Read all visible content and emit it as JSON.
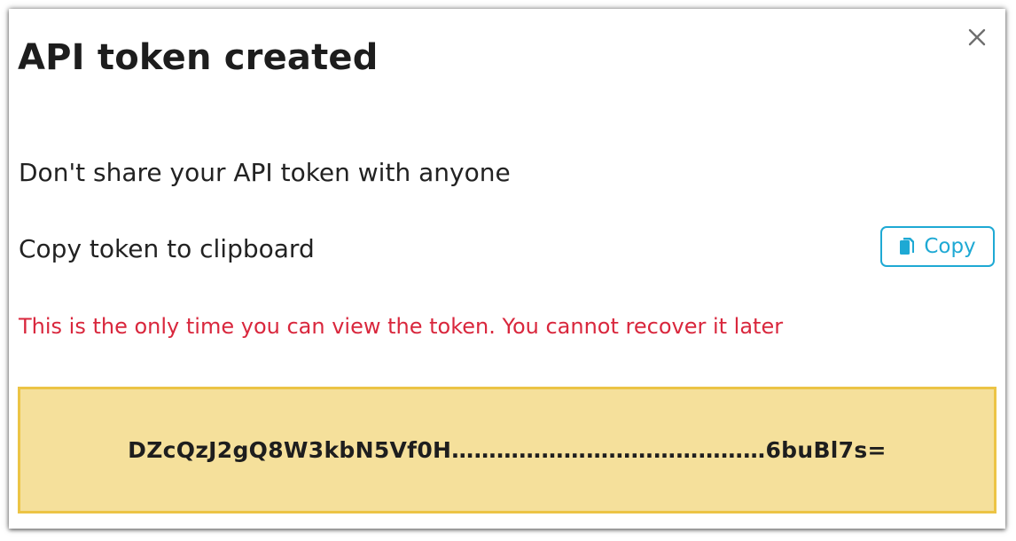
{
  "dialog": {
    "title": "API token created",
    "close_icon": "close-icon",
    "share_notice": "Don't share your API token with anyone",
    "copy_label": "Copy token to clipboard",
    "copy_button": {
      "label": "Copy",
      "icon": "copy-icon"
    },
    "warning": "This is the only time you can view the token. You cannot recover it later",
    "token": "DZcQzJ2gQ8W3kbN5Vf0H……………………………………6buBl7s="
  },
  "colors": {
    "accent": "#1ea9d4",
    "warning": "#d9273d",
    "token_background": "#f5e09b",
    "token_border": "#ecc445"
  }
}
